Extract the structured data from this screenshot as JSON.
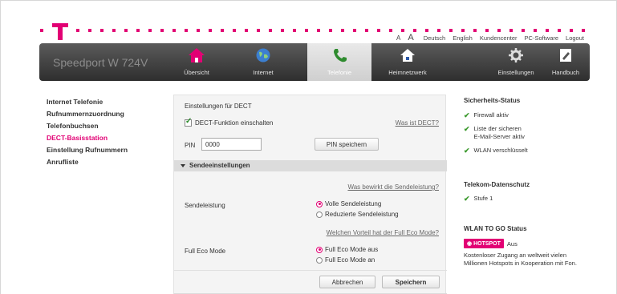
{
  "toplinks": {
    "font_small": "A",
    "font_big": "A",
    "deutsch": "Deutsch",
    "english": "English",
    "kundencenter": "Kundencenter",
    "pcsoftware": "PC-Software",
    "logout": "Logout"
  },
  "navbar": {
    "product": "Speedport W 724V",
    "items": [
      {
        "label": "Übersicht",
        "icon": "home-icon"
      },
      {
        "label": "Internet",
        "icon": "globe-icon"
      },
      {
        "label": "Telefonie",
        "icon": "phone-icon"
      },
      {
        "label": "Heimnetzwerk",
        "icon": "home-network-icon"
      },
      {
        "label": "Einstellungen",
        "icon": "gear-icon"
      },
      {
        "label": "Handbuch",
        "icon": "manual-icon"
      }
    ],
    "active": "Telefonie"
  },
  "sidebar": {
    "items": [
      {
        "label": "Internet Telefonie"
      },
      {
        "label": "Rufnummernzuordnung"
      },
      {
        "label": "Telefonbuchsen"
      },
      {
        "label": "DECT-Basisstation"
      },
      {
        "label": "Einstellung Rufnummern"
      },
      {
        "label": "Anrufliste"
      }
    ],
    "active": "DECT-Basisstation"
  },
  "main": {
    "title": "Einstellungen für DECT",
    "dect_checkbox_label": "DECT-Funktion einschalten",
    "dect_checked": true,
    "help_dect": "Was ist DECT?",
    "pin_label": "PIN",
    "pin_value": "0000",
    "pin_save": "PIN speichern",
    "section_title": "Sendeeinstellungen",
    "help_power": "Was bewirkt die Sendeleistung?",
    "power_label": "Sendeleistung",
    "power_options": [
      "Volle Sendeleistung",
      "Reduzierte Sendeleistung"
    ],
    "power_selected": "Volle Sendeleistung",
    "help_eco": "Welchen Vorteil hat der Full Eco Mode?",
    "eco_label": "Full Eco Mode",
    "eco_options": [
      "Full Eco Mode aus",
      "Full Eco Mode an"
    ],
    "eco_selected": "Full Eco Mode aus",
    "cancel": "Abbrechen",
    "save": "Speichern"
  },
  "right": {
    "security_title": "Sicherheits-Status",
    "security_items": [
      "Firewall aktiv",
      "Liste der sicheren",
      "E-Mail-Server aktiv",
      "WLAN verschlüsselt"
    ],
    "privacy_title": "Telekom-Datenschutz",
    "privacy_level": "Stufe 1",
    "wlan_title": "WLAN TO GO Status",
    "hotspot_badge": "HOTSPOT",
    "hotspot_status": "Aus",
    "hotspot_text_1": "Kostenloser Zugang an weltweit vielen",
    "hotspot_text_2": "Millionen Hotspots in Kooperation mit Fon."
  },
  "colors": {
    "brand_magenta": "#e20074",
    "check_green": "#3d9a2f"
  }
}
